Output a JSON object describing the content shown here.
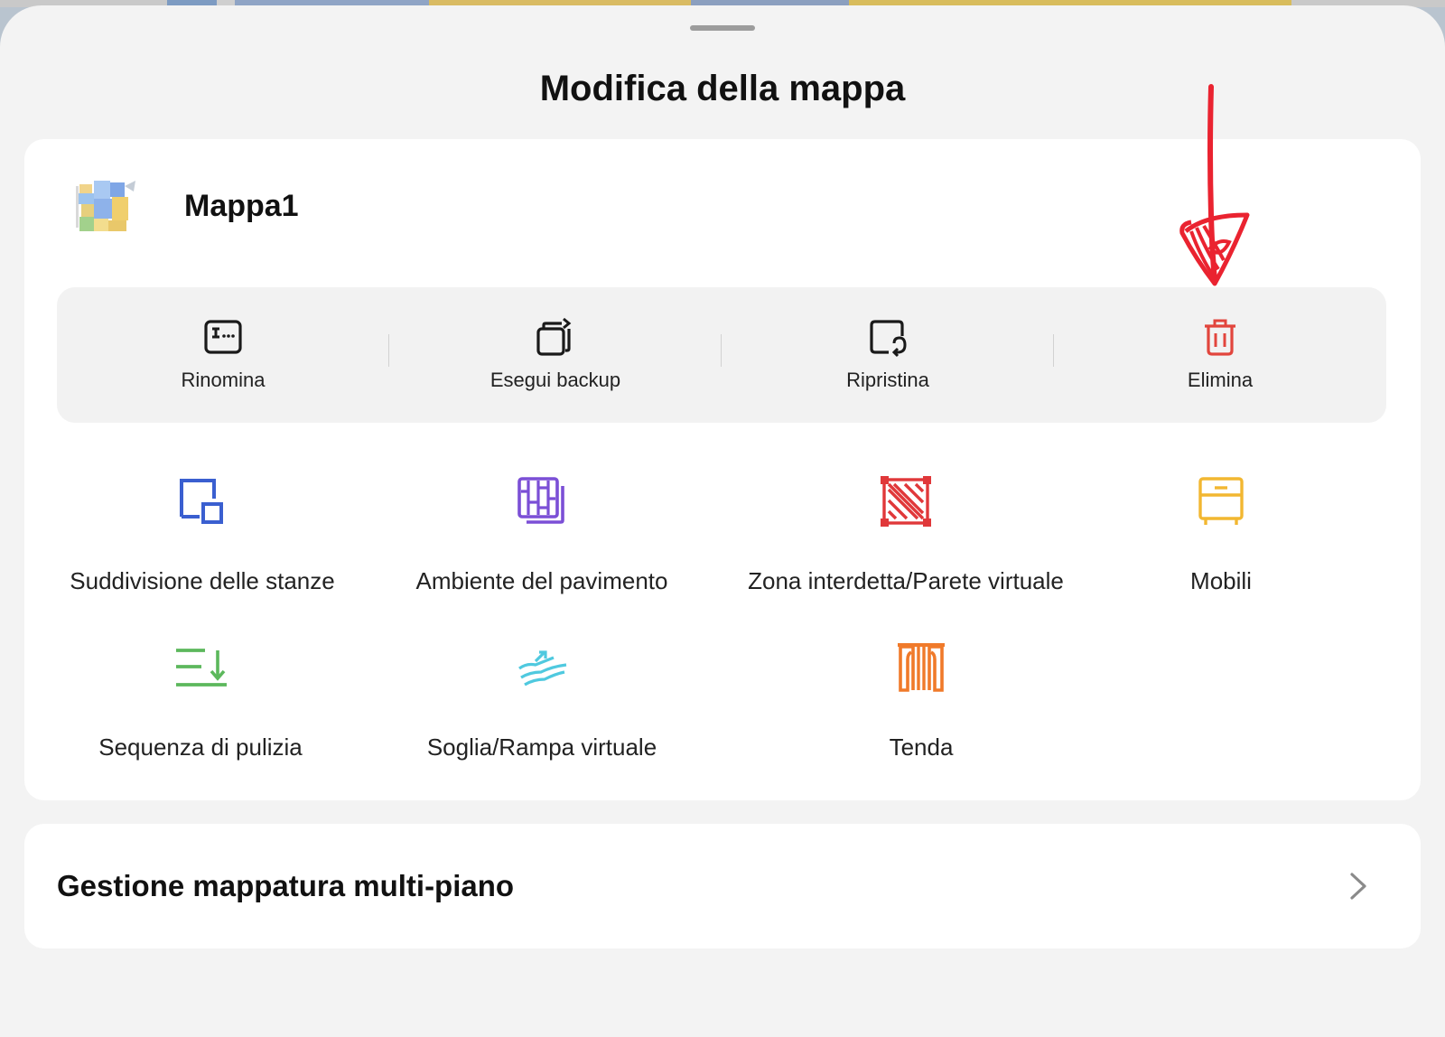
{
  "sheet": {
    "title": "Modifica della mappa"
  },
  "map": {
    "name": "Mappa1",
    "thumbnail_icon": "floor-map-thumbnail"
  },
  "actions": [
    {
      "label": "Rinomina",
      "icon": "rename-icon",
      "color": "#1a1a1a"
    },
    {
      "label": "Esegui backup",
      "icon": "backup-icon",
      "color": "#1a1a1a"
    },
    {
      "label": "Ripristina",
      "icon": "restore-icon",
      "color": "#1a1a1a"
    },
    {
      "label": "Elimina",
      "icon": "trash-icon",
      "color": "#e2453d"
    }
  ],
  "tools": [
    {
      "label": "Suddivisione delle stanze",
      "icon": "room-divide-icon",
      "color": "#3a5fd0"
    },
    {
      "label": "Ambiente del pavimento",
      "icon": "floor-material-icon",
      "color": "#7b4fd6"
    },
    {
      "label": "Zona interdetta/Parete virtuale",
      "icon": "no-go-zone-icon",
      "color": "#e0383a"
    },
    {
      "label": "Mobili",
      "icon": "furniture-icon",
      "color": "#f2b731"
    },
    {
      "label": "Sequenza di pulizia",
      "icon": "cleaning-sequence-icon",
      "color": "#5cb85c"
    },
    {
      "label": "Soglia/Rampa virtuale",
      "icon": "threshold-ramp-icon",
      "color": "#4fc9df"
    },
    {
      "label": "Tenda",
      "icon": "curtain-icon",
      "color": "#f07a2a"
    }
  ],
  "multi_floor": {
    "label": "Gestione mappatura multi-piano",
    "chevron_icon": "chevron-right-icon"
  },
  "annotation": {
    "icon": "red-hand-drawn-arrow-icon",
    "color": "#ea2330"
  }
}
